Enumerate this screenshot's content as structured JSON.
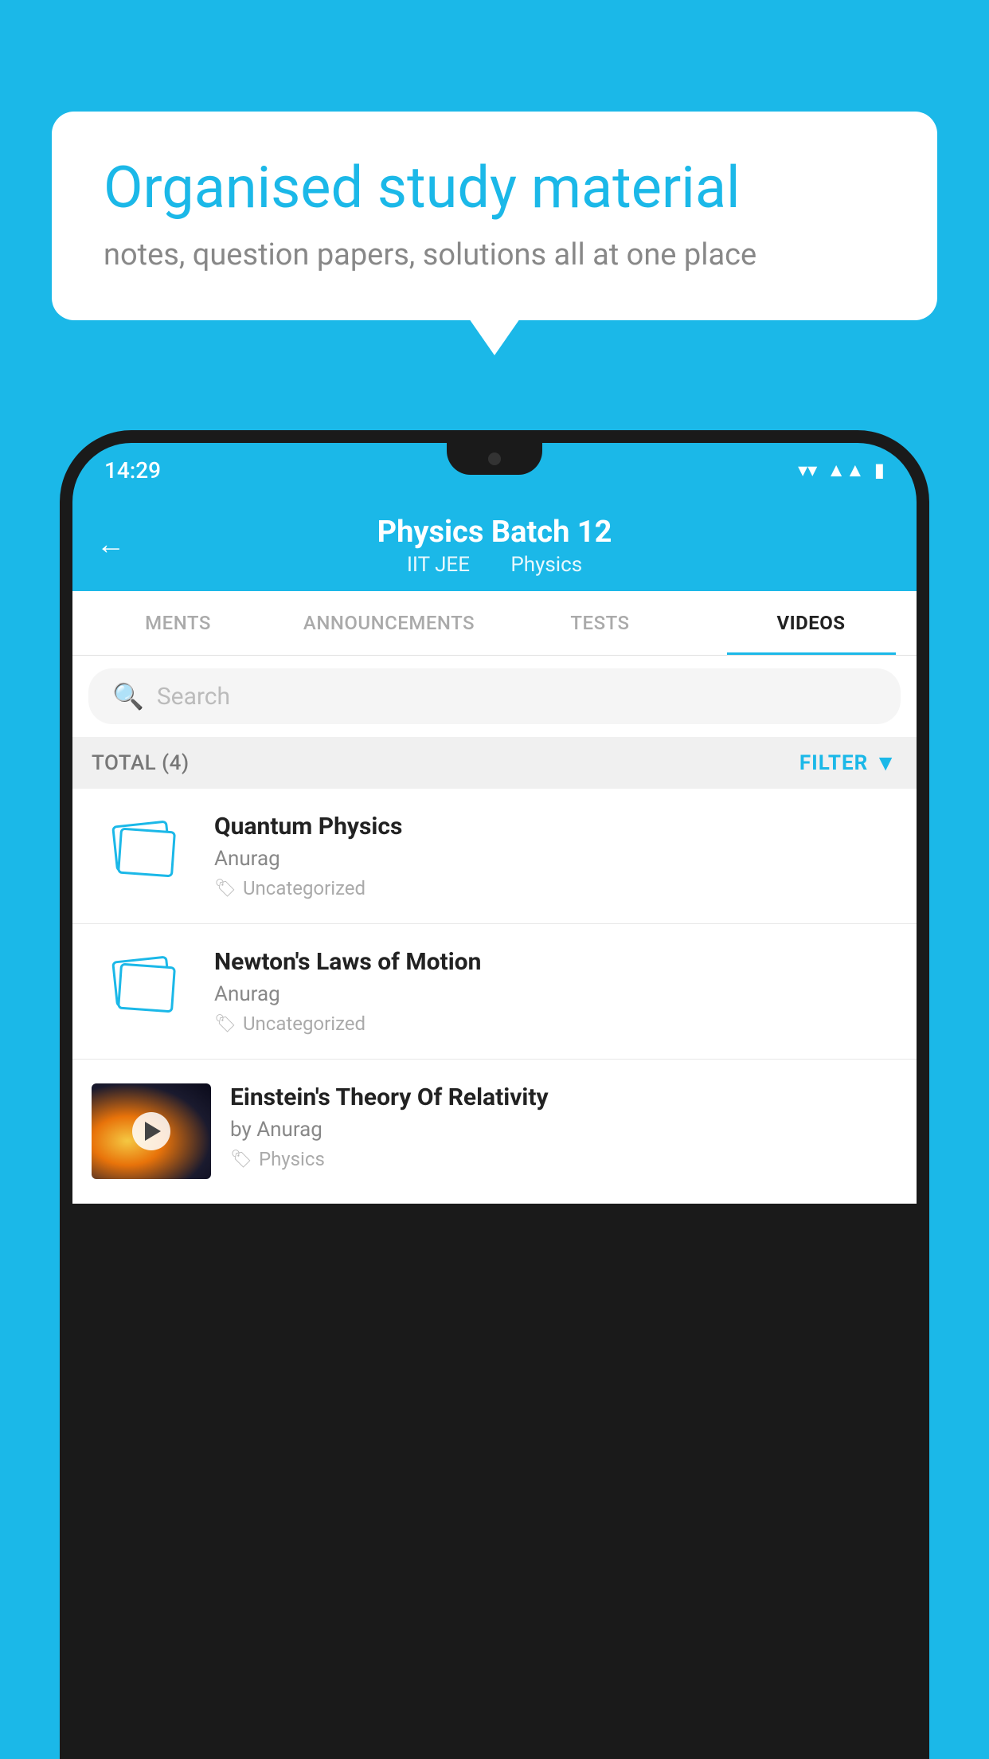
{
  "bubble": {
    "title": "Organised study material",
    "subtitle": "notes, question papers, solutions all at one place"
  },
  "statusBar": {
    "time": "14:29",
    "icons": [
      "wifi",
      "signal",
      "battery"
    ]
  },
  "header": {
    "back_label": "←",
    "title": "Physics Batch 12",
    "subtitle_part1": "IIT JEE",
    "subtitle_part2": "Physics"
  },
  "tabs": [
    {
      "label": "MENTS",
      "active": false
    },
    {
      "label": "ANNOUNCEMENTS",
      "active": false
    },
    {
      "label": "TESTS",
      "active": false
    },
    {
      "label": "VIDEOS",
      "active": true
    }
  ],
  "search": {
    "placeholder": "Search"
  },
  "filterBar": {
    "total_label": "TOTAL (4)",
    "filter_label": "FILTER"
  },
  "videos": [
    {
      "title": "Quantum Physics",
      "author": "Anurag",
      "tag": "Uncategorized",
      "has_thumb": false
    },
    {
      "title": "Newton's Laws of Motion",
      "author": "Anurag",
      "tag": "Uncategorized",
      "has_thumb": false
    },
    {
      "title": "Einstein's Theory Of Relativity",
      "author": "by Anurag",
      "tag": "Physics",
      "has_thumb": true
    }
  ]
}
